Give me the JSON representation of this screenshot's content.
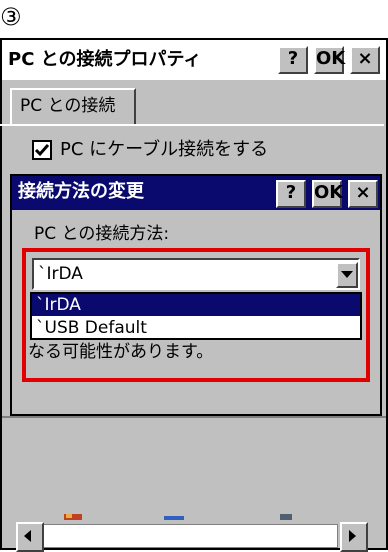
{
  "step_marker": "③",
  "outer_window": {
    "title": "PC との接続プロパティ",
    "help_label": "?",
    "ok_label": "OK",
    "close_label": "×"
  },
  "tabs": [
    {
      "label": "PC との接続"
    }
  ],
  "checkbox": {
    "label": "PC にケーブル接続をする",
    "checked": true
  },
  "dialog": {
    "title": "接続方法の変更",
    "help_label": "?",
    "ok_label": "OK",
    "close_label": "×",
    "field_label": "PC との接続方法:",
    "selected_value": "`IrDA",
    "options": [
      "`IrDA",
      "`USB Default"
    ],
    "partially_hidden_text": "なる可能性があります。"
  },
  "colors": {
    "title_bar_dark": "#0a0a6e",
    "highlight": "#e00000",
    "face": "#c0c0c0"
  }
}
